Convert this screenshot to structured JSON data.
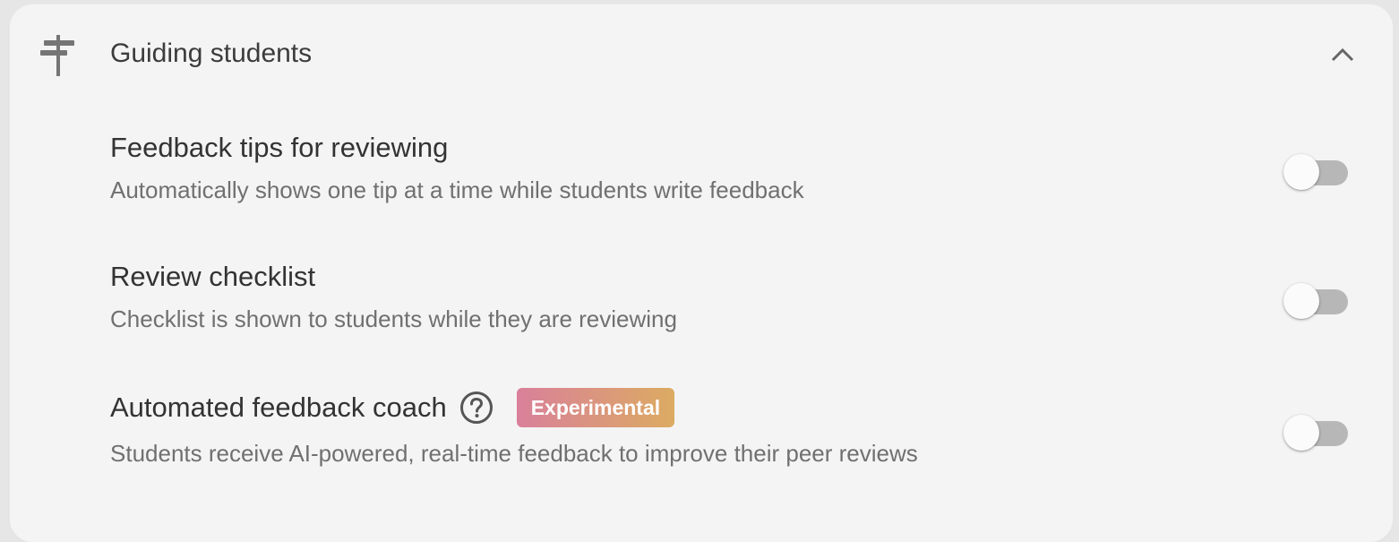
{
  "section": {
    "title": "Guiding students",
    "icon": "signpost-icon",
    "collapse_icon": "chevron-up-icon"
  },
  "settings": [
    {
      "title": "Feedback tips for reviewing",
      "description": "Automatically shows one tip at a time while students write feedback",
      "enabled": false
    },
    {
      "title": "Review checklist",
      "description": "Checklist is shown to students while they are reviewing",
      "enabled": false
    },
    {
      "title": "Automated feedback coach",
      "description": "Students receive AI-powered, real-time feedback to improve their peer reviews",
      "help_icon": "help-circle-icon",
      "badge": "Experimental",
      "enabled": false
    }
  ],
  "colors": {
    "toggle_off_track": "#b7b7b7",
    "badge_gradient_start": "#d9809a",
    "badge_gradient_end": "#dcab62"
  }
}
